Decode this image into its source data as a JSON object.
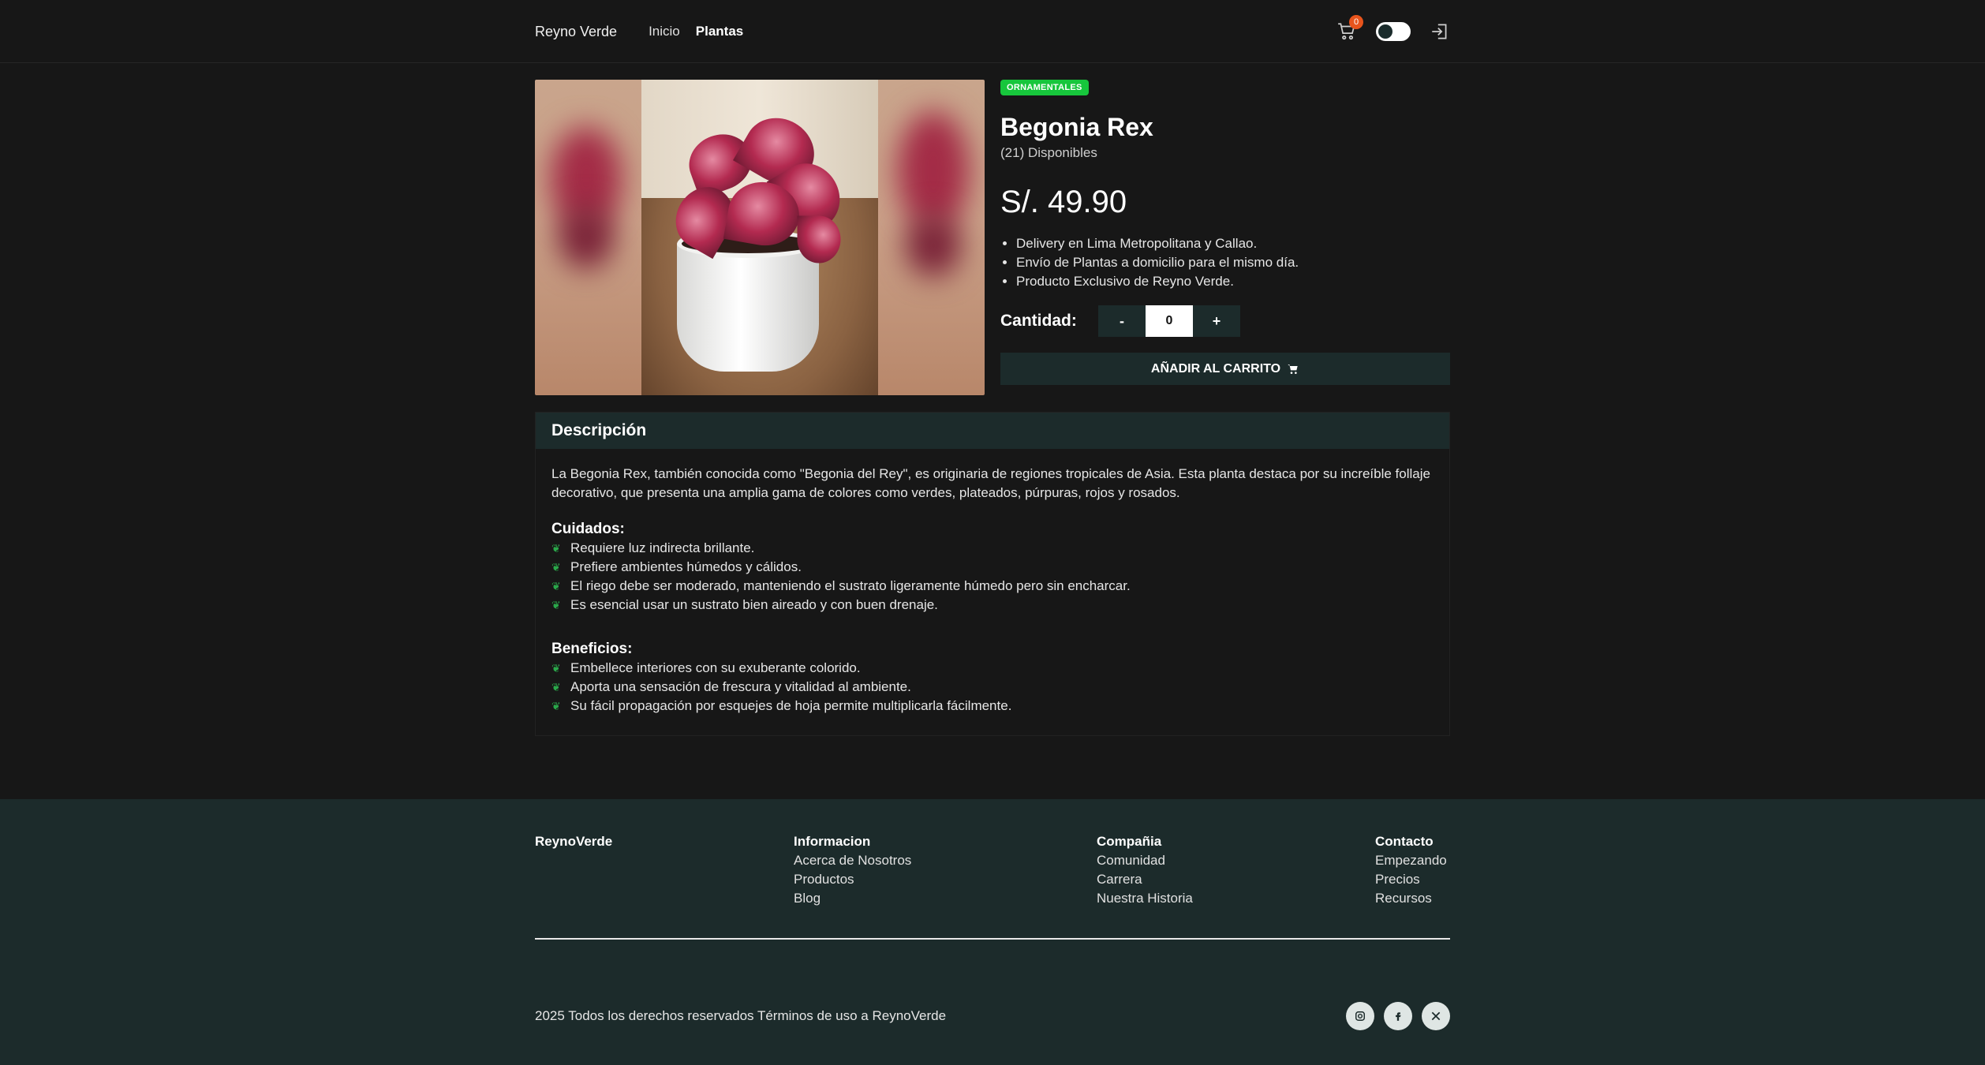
{
  "header": {
    "brand": "Reyno Verde",
    "nav": [
      {
        "label": "Inicio",
        "active": false
      },
      {
        "label": "Plantas",
        "active": true
      }
    ],
    "cart_count": "0",
    "icons": [
      "cart-icon",
      "theme-toggle",
      "logout-icon"
    ]
  },
  "product": {
    "category_tag": "ORNAMENTALES",
    "name": "Begonia Rex",
    "stock": "(21) Disponibles",
    "price": "S/. 49.90",
    "bullets": [
      "Delivery en Lima Metropolitana y Callao.",
      "Envío de Plantas a domicilio para el mismo día.",
      "Producto Exclusivo de Reyno Verde."
    ],
    "quantity_label": "Cantidad:",
    "minus": "-",
    "quantity": "0",
    "plus": "+",
    "add_to_cart": "AÑADIR AL CARRITO"
  },
  "description": {
    "heading": "Descripción",
    "intro": "La Begonia Rex, también conocida como \"Begonia del Rey\", es originaria de regiones tropicales de Asia. Esta planta destaca por su increíble follaje decorativo, que presenta una amplia gama de colores como verdes, plateados, púrpuras, rojos y rosados.",
    "care_title": "Cuidados:",
    "care": [
      "Requiere luz indirecta brillante.",
      "Prefiere ambientes húmedos y cálidos.",
      "El riego debe ser moderado, manteniendo el sustrato ligeramente húmedo pero sin encharcar.",
      "Es esencial usar un sustrato bien aireado y con buen drenaje."
    ],
    "benefits_title": "Beneficios:",
    "benefits": [
      "Embellece interiores con su exuberante colorido.",
      "Aporta una sensación de frescura y vitalidad al ambiente.",
      "Su fácil propagación por esquejes de hoja permite multiplicarla fácilmente."
    ]
  },
  "footer": {
    "brand": "ReynoVerde",
    "columns": [
      {
        "title": "Informacion",
        "links": [
          "Acerca de Nosotros",
          "Productos",
          "Blog"
        ]
      },
      {
        "title": "Compañia",
        "links": [
          "Comunidad",
          "Carrera",
          "Nuestra Historia"
        ]
      },
      {
        "title": "Contacto",
        "links": [
          "Empezando",
          "Precios",
          "Recursos"
        ]
      }
    ],
    "copyright": "2025 Todos los derechos reservados Términos de uso a ReynoVerde",
    "social": [
      "instagram-icon",
      "facebook-icon",
      "x-icon"
    ]
  }
}
